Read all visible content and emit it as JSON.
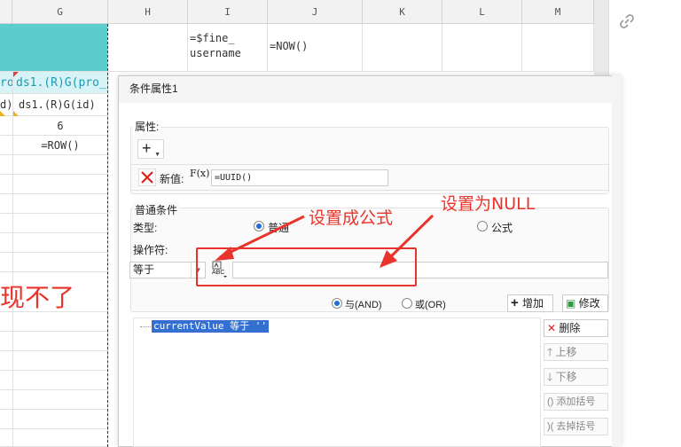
{
  "sheet": {
    "columns": [
      {
        "label": "G"
      },
      {
        "label": "H"
      },
      {
        "label": "I"
      },
      {
        "label": "J"
      },
      {
        "label": "K"
      },
      {
        "label": "L"
      },
      {
        "label": "M"
      }
    ],
    "i2_line1": "=$fine_",
    "i2_line2": "username",
    "j2": "=NOW()",
    "f_hdr": "ro_",
    "g_hdr": "ds1.(R)G(pro_",
    "f_row": "d)",
    "g_row": "ds1.(R)G(id)",
    "g_val": "6",
    "g_formula": "=ROW()",
    "red_text": "现不了"
  },
  "dialog": {
    "title": "条件属性1",
    "attr_label": "属性:",
    "new_value_label": "新值:",
    "fx_label": "F(x)",
    "new_value": "=UUID()",
    "normal_cond_label": "普通条件",
    "type_label": "类型:",
    "type_normal": "普通",
    "type_formula": "公式",
    "operator_label": "操作符:",
    "operator_value": "等于",
    "abc_label": "ABC",
    "and_label": "与(AND)",
    "or_label": "或(OR)",
    "add_label": "增加",
    "modify_label": "修改",
    "condition_text": "currentValue 等于 ''",
    "delete_label": "删除",
    "up_label": "上移",
    "down_label": "下移",
    "add_bracket_label": "添加括号",
    "remove_bracket_label": "去掉括号"
  },
  "annotations": {
    "formula_note": "设置成公式",
    "null_note": "设置为NULL"
  },
  "colors": {
    "accent_red": "#e8342a",
    "teal": "#5ccccc",
    "selection_blue": "#3370d0"
  }
}
